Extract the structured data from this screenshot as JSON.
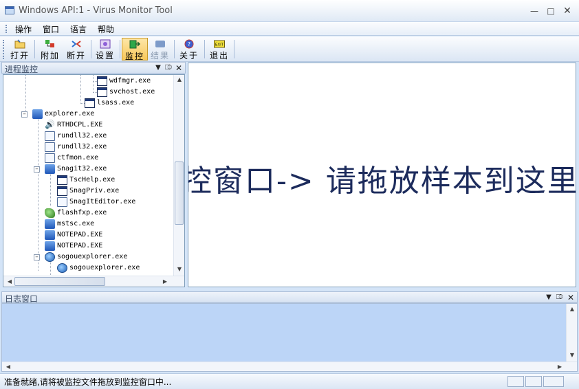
{
  "window": {
    "title": "Windows API:1 - Virus Monitor Tool"
  },
  "menu": [
    "操作",
    "窗口",
    "语言",
    "帮助"
  ],
  "toolbar": {
    "buttons": [
      {
        "label": "打开",
        "icon": "folder-open-icon"
      },
      {
        "label": "附加",
        "icon": "attach-icon"
      },
      {
        "label": "断开",
        "icon": "detach-icon"
      },
      {
        "label": "设置",
        "icon": "settings-icon"
      },
      {
        "label": "监控",
        "icon": "monitor-icon"
      },
      {
        "label": "结果",
        "icon": "result-icon"
      },
      {
        "label": "关于",
        "icon": "about-icon"
      },
      {
        "label": "退出",
        "icon": "exit-icon",
        "badge": "EXIT"
      }
    ]
  },
  "process_panel": {
    "title": "进程监控",
    "tree": [
      {
        "label": "wdfmgr.exe",
        "icon": "window"
      },
      {
        "label": "svchost.exe",
        "icon": "window"
      },
      {
        "label": "lsass.exe",
        "icon": "window"
      },
      {
        "label": "explorer.exe",
        "icon": "blue"
      },
      {
        "label": "RTHDCPL.EXE",
        "icon": "speaker"
      },
      {
        "label": "rundll32.exe",
        "icon": "doc"
      },
      {
        "label": "rundll32.exe",
        "icon": "doc"
      },
      {
        "label": "ctfmon.exe",
        "icon": "doc"
      },
      {
        "label": "Snagit32.exe",
        "icon": "blue"
      },
      {
        "label": "TscHelp.exe",
        "icon": "window"
      },
      {
        "label": "SnagPriv.exe",
        "icon": "window"
      },
      {
        "label": "SnagItEditor.exe",
        "icon": "doc"
      },
      {
        "label": "flashfxp.exe",
        "icon": "green"
      },
      {
        "label": "mstsc.exe",
        "icon": "blue"
      },
      {
        "label": "NOTEPAD.EXE",
        "icon": "blue"
      },
      {
        "label": "NOTEPAD.EXE",
        "icon": "blue"
      },
      {
        "label": "sogouexplorer.exe",
        "icon": "globe"
      },
      {
        "label": "sogouexplorer.exe",
        "icon": "globe"
      }
    ]
  },
  "drop_area": {
    "text": "控窗口-> 请拖放样本到这里"
  },
  "log_panel": {
    "title": "日志窗口"
  },
  "status": {
    "text": "准备就绪,请将被监控文件拖放到监控窗口中..."
  },
  "colors": {
    "accent": "#f8c85a",
    "panel_bg": "#bcd5f7",
    "drop_text": "#1c2b5c"
  }
}
